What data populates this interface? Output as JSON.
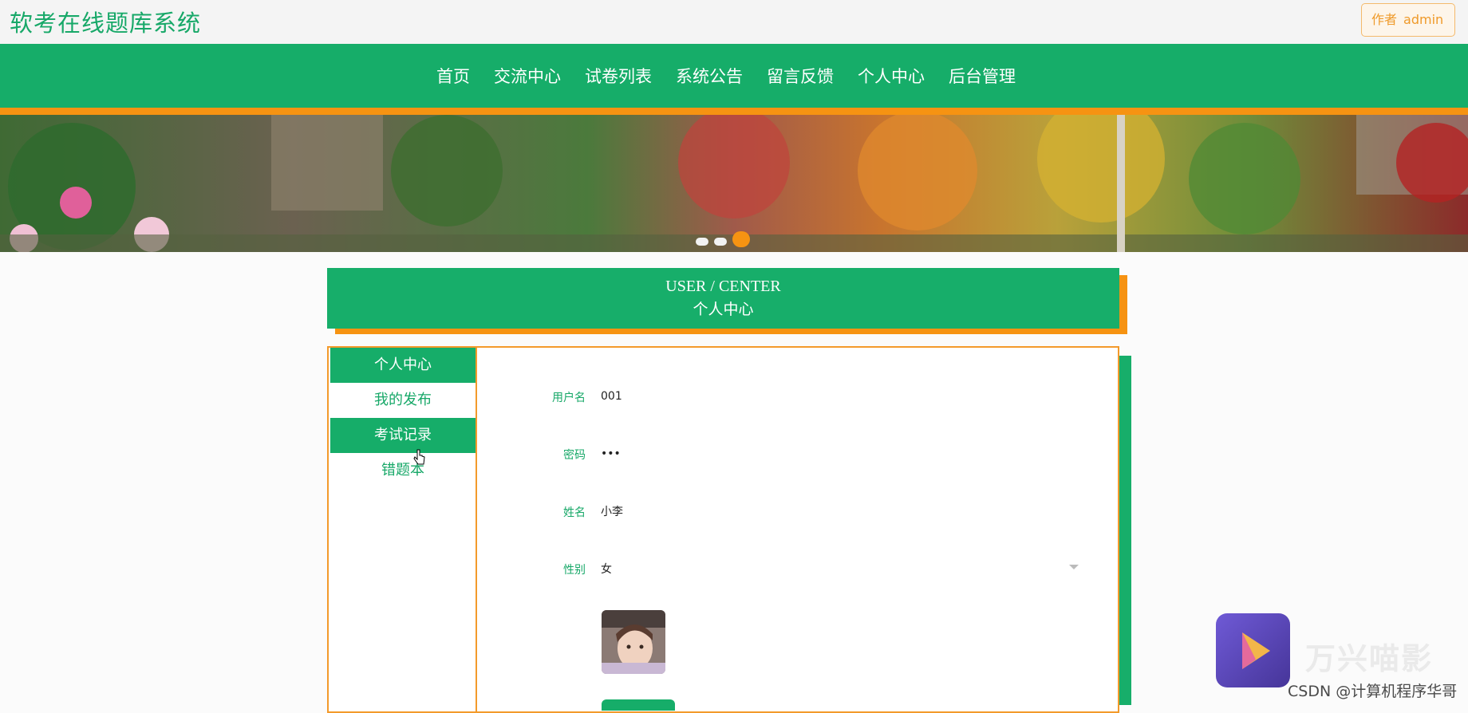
{
  "site": {
    "title": "软考在线题库系统"
  },
  "author": {
    "label": "作者",
    "name": "admin"
  },
  "nav": {
    "items": [
      "首页",
      "交流中心",
      "试卷列表",
      "系统公告",
      "留言反馈",
      "个人中心",
      "后台管理"
    ]
  },
  "banner": {
    "slide_count": 3,
    "active_slide": 3
  },
  "section": {
    "title_en": "USER / CENTER",
    "title_cn": "个人中心"
  },
  "sidebar": {
    "items": [
      {
        "label": "个人中心",
        "active": true
      },
      {
        "label": "我的发布",
        "active": false
      },
      {
        "label": "考试记录",
        "active": true
      },
      {
        "label": "错题本",
        "active": false
      }
    ]
  },
  "form": {
    "username": {
      "label": "用户名",
      "value": "001"
    },
    "password": {
      "label": "密码",
      "value": "•••"
    },
    "name": {
      "label": "姓名",
      "value": "小李"
    },
    "gender": {
      "label": "性别",
      "value": "女"
    }
  },
  "overlay": {
    "player_text": "万兴喵影",
    "watermark": "CSDN @计算机程序华哥"
  },
  "colors": {
    "primary": "#16ad69",
    "accent": "#f69312"
  }
}
